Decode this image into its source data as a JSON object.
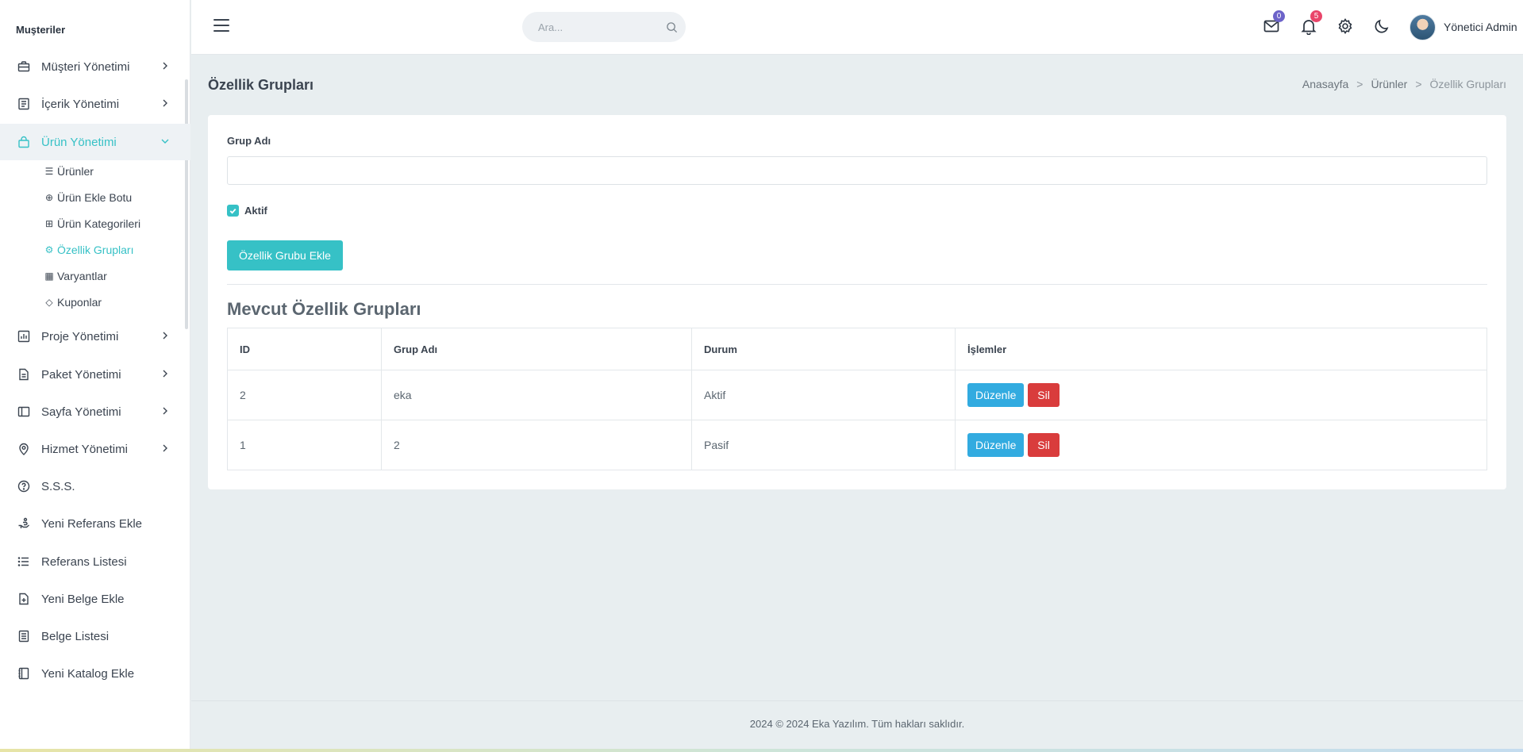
{
  "sidebar": {
    "section_title": "Muşteriler",
    "items": [
      {
        "label": "Müşteri Yönetimi",
        "icon": "briefcase-icon"
      },
      {
        "label": "İçerik Yönetimi",
        "icon": "document-icon"
      },
      {
        "label": "Ürün Yönetimi",
        "icon": "bag-icon"
      },
      {
        "label": "Proje Yönetimi",
        "icon": "chart-icon"
      },
      {
        "label": "Paket Yönetimi",
        "icon": "file-icon"
      },
      {
        "label": "Sayfa Yönetimi",
        "icon": "layout-icon"
      },
      {
        "label": "Hizmet Yönetimi",
        "icon": "location-icon"
      },
      {
        "label": "S.S.S.",
        "icon": "question-icon"
      },
      {
        "label": "Yeni Referans Ekle",
        "icon": "hand-icon"
      },
      {
        "label": "Referans Listesi",
        "icon": "list-icon"
      },
      {
        "label": "Yeni Belge Ekle",
        "icon": "file-plus-icon"
      },
      {
        "label": "Belge Listesi",
        "icon": "file-text-icon"
      },
      {
        "label": "Yeni Katalog Ekle",
        "icon": "book-icon"
      }
    ],
    "sub_items": [
      {
        "label": "Ürünler",
        "icon": "☰"
      },
      {
        "label": "Ürün Ekle Botu",
        "icon": "⊕"
      },
      {
        "label": "Ürün Kategorileri",
        "icon": "⊞"
      },
      {
        "label": "Özellik Grupları",
        "icon": "⚙"
      },
      {
        "label": "Varyantlar",
        "icon": "▦"
      },
      {
        "label": "Kuponlar",
        "icon": "◇"
      }
    ]
  },
  "topbar": {
    "search_placeholder": "Ara...",
    "mail_badge": "0",
    "notif_badge": "5",
    "user_name": "Yönetici Admin"
  },
  "colors": {
    "accent": "#36c1c6",
    "mail_badge": "#6c63c9",
    "notif_badge": "#e9456a",
    "edit": "#32abe0",
    "delete": "#d93c3c"
  },
  "page": {
    "title": "Özellik Grupları",
    "breadcrumb": [
      "Anasayfa",
      "Ürünler",
      "Özellik Grupları"
    ]
  },
  "form": {
    "group_name_label": "Grup Adı",
    "group_name_value": "",
    "active_label": "Aktif",
    "active_checked": true,
    "submit_label": "Özellik Grubu Ekle"
  },
  "list": {
    "heading": "Mevcut Özellik Grupları",
    "columns": [
      "ID",
      "Grup Adı",
      "Durum",
      "İşlemler"
    ],
    "rows": [
      {
        "id": "2",
        "name": "eka",
        "status": "Aktif",
        "edit": "Düzenle",
        "delete": "Sil"
      },
      {
        "id": "1",
        "name": "2",
        "status": "Pasif",
        "edit": "Düzenle",
        "delete": "Sil"
      }
    ]
  },
  "footer": {
    "text": "2024 © 2024 Eka Yazılım. Tüm hakları saklıdır."
  }
}
